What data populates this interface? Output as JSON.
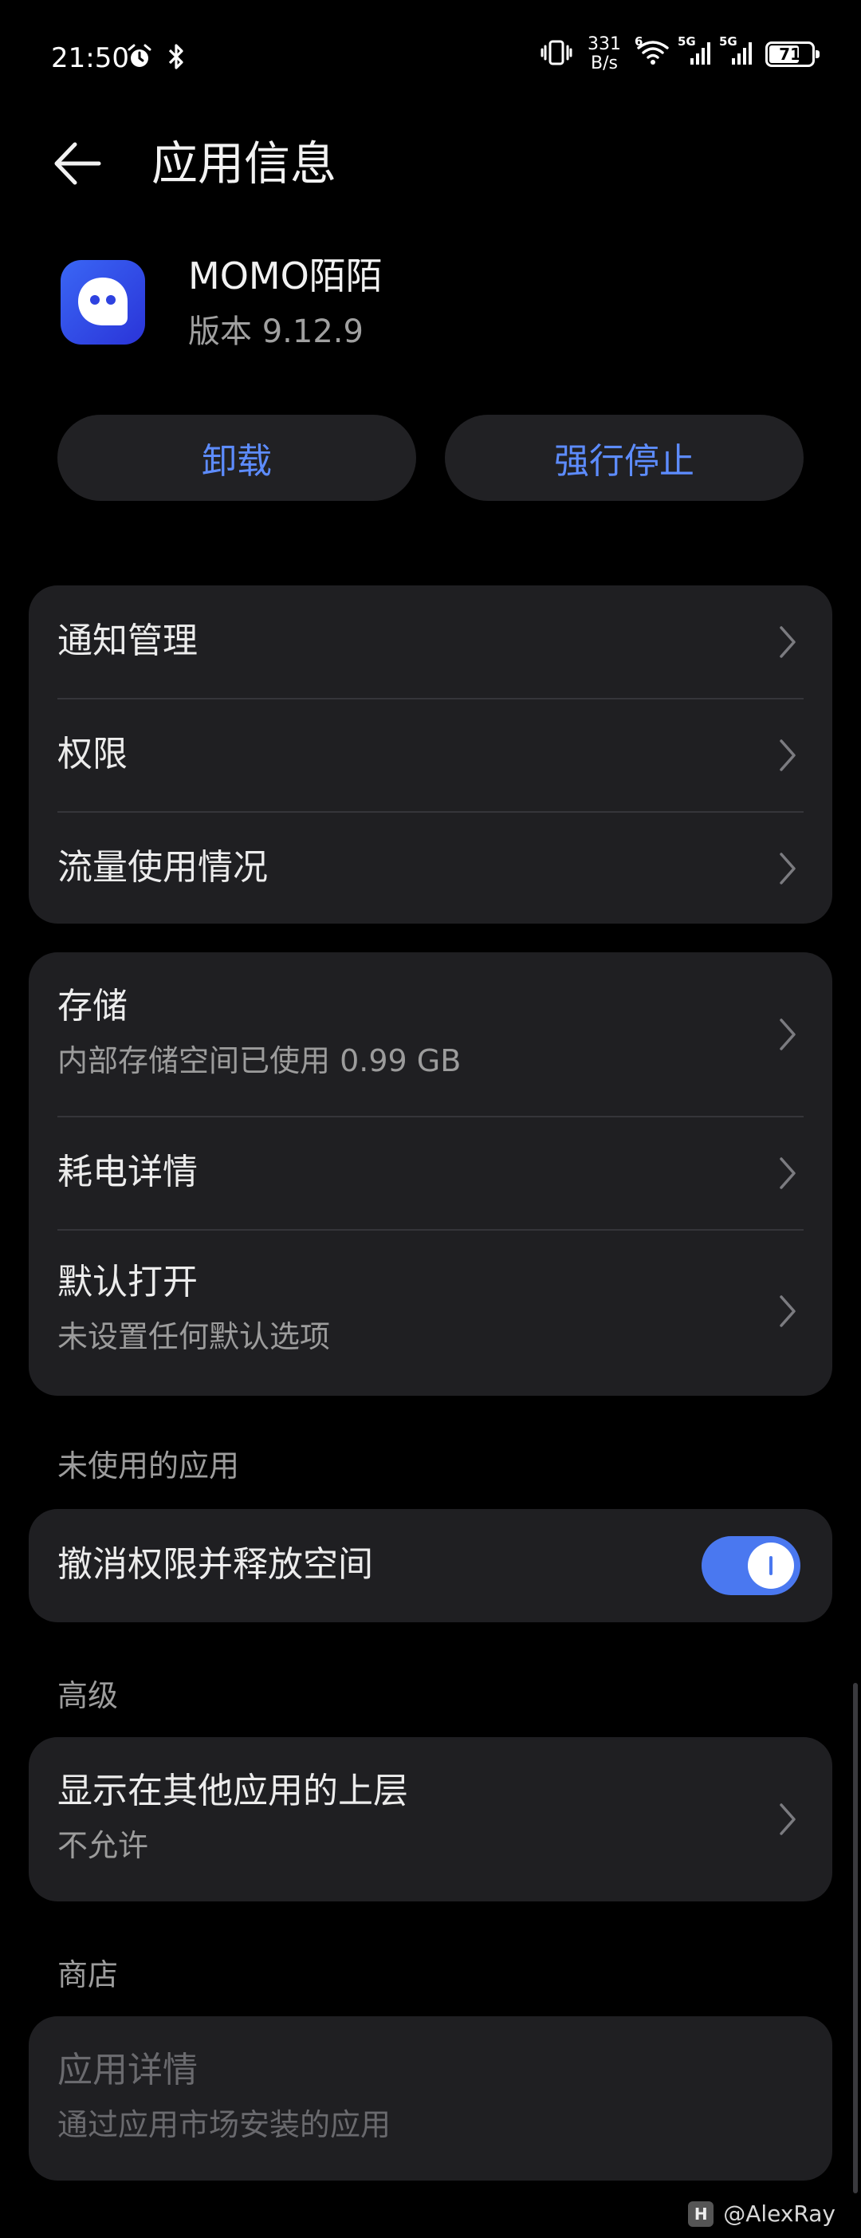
{
  "status_bar": {
    "time": "21:50",
    "net_speed_value": "331",
    "net_speed_unit": "B/s",
    "wifi_tag": "6",
    "sim1_tag": "5G",
    "sim2_tag": "5G",
    "battery_level": "71",
    "battery_fraction": 0.71
  },
  "header": {
    "title": "应用信息"
  },
  "app": {
    "name": "MOMO陌陌",
    "version": "版本 9.12.9",
    "icon_color": "#3a66f5"
  },
  "actions": {
    "uninstall_label": "卸载",
    "force_stop_label": "强行停止"
  },
  "group1": [
    {
      "title": "通知管理"
    },
    {
      "title": "权限"
    },
    {
      "title": "流量使用情况"
    }
  ],
  "group2": [
    {
      "title": "存储",
      "subtitle": "内部存储空间已使用 0.99 GB"
    },
    {
      "title": "耗电详情"
    },
    {
      "title": "默认打开",
      "subtitle": "未设置任何默认选项"
    }
  ],
  "unused_section": {
    "label": "未使用的应用",
    "toggle_title": "撤消权限并释放空间",
    "toggle_on": true
  },
  "advanced_section": {
    "label": "高级",
    "overlay_title": "显示在其他应用的上层",
    "overlay_subtitle": "不允许"
  },
  "store_section": {
    "label": "商店",
    "details_title": "应用详情",
    "details_subtitle": "通过应用市场安装的应用"
  },
  "watermark": {
    "text": "@AlexRay"
  },
  "colors": {
    "accent": "#5d8cff",
    "toggle": "#4a78f0",
    "card": "#1f1f22",
    "background": "#000000"
  }
}
